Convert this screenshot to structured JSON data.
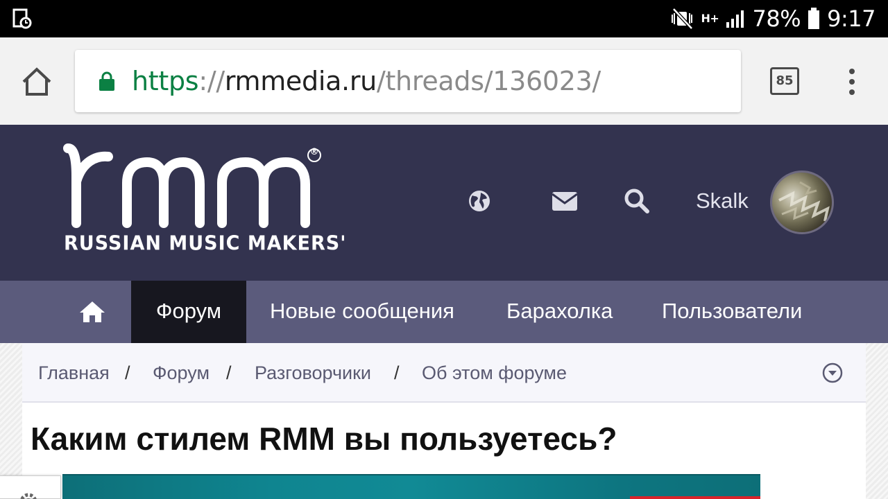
{
  "status_bar": {
    "battery": "78%",
    "time": "9:17",
    "network": "H+"
  },
  "browser": {
    "url_scheme": "https",
    "url_sep": "://",
    "url_host": "rmmedia.ru",
    "url_path": "/threads/136023/",
    "tab_count": "85"
  },
  "header": {
    "logo_text": "rmm",
    "logo_sub": "RUSSIAN MUSIC MAKERS'",
    "logo_reg": "®",
    "username": "Skalk"
  },
  "nav": {
    "items": [
      "Форум",
      "Новые сообщения",
      "Барахолка",
      "Пользователи"
    ]
  },
  "breadcrumb": {
    "items": [
      "Главная",
      "Форум",
      "Разговорчики",
      "Об этом форуме"
    ],
    "sep": "/"
  },
  "thread": {
    "title": "Каким стилем RMM вы пользуетесь?"
  },
  "colors": {
    "header_bg": "#33334f",
    "nav_bg": "#5b5b7c",
    "nav_active": "#17171f",
    "url_green": "#0b8043"
  }
}
